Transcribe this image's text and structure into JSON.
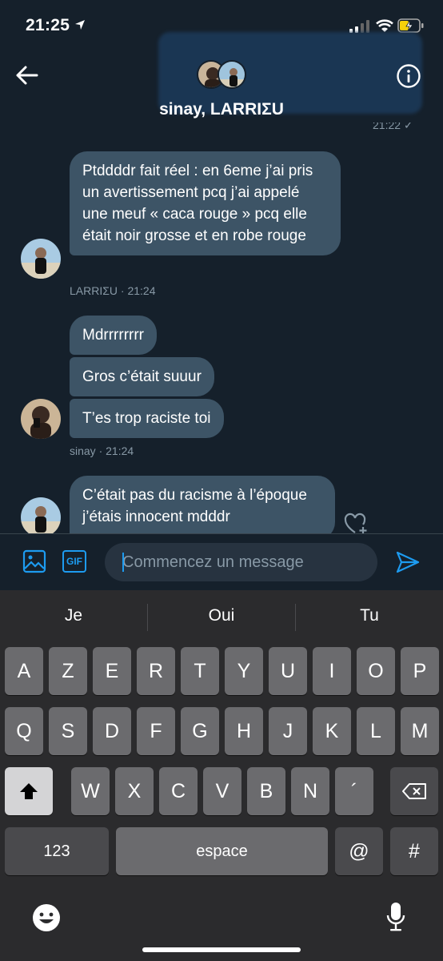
{
  "status_bar": {
    "time": "21:25"
  },
  "header": {
    "title": "sinay, LARRIΣU",
    "partial_timestamp": "21:22 ✓"
  },
  "messages": [
    {
      "text": "Ptddddr fait réel : en 6eme j’ai pris un avertissement pcq j’ai appelé une meuf « caca rouge » pcq elle était noir grosse et en robe rouge"
    },
    {
      "text": "Mdrrrrrrrr"
    },
    {
      "text": "Gros c’était suuur"
    },
    {
      "text": "T’es trop raciste toi"
    },
    {
      "text": "C’était pas du racisme à l’époque j’étais innocent mdddr"
    }
  ],
  "meta": [
    {
      "sender": "LARRIΣU",
      "time": "· 21:24"
    },
    {
      "sender": "sinay",
      "time": "· 21:24"
    }
  ],
  "composer": {
    "placeholder": "Commencez un message",
    "gif_label": "GIF"
  },
  "keyboard": {
    "suggestions": [
      "Je",
      "Oui",
      "Tu"
    ],
    "row1": [
      "A",
      "Z",
      "E",
      "R",
      "T",
      "Y",
      "U",
      "I",
      "O",
      "P"
    ],
    "row2": [
      "Q",
      "S",
      "D",
      "F",
      "G",
      "H",
      "J",
      "K",
      "L",
      "M"
    ],
    "row3": [
      "W",
      "X",
      "C",
      "V",
      "B",
      "N",
      "´"
    ],
    "numbers_key": "123",
    "space_key": "espace",
    "at_key": "@",
    "hash_key": "#"
  },
  "colors": {
    "background": "#15202b",
    "bubble": "#3d5466",
    "accent": "#1d9bf0",
    "keyboard": "#2b2b2d"
  }
}
